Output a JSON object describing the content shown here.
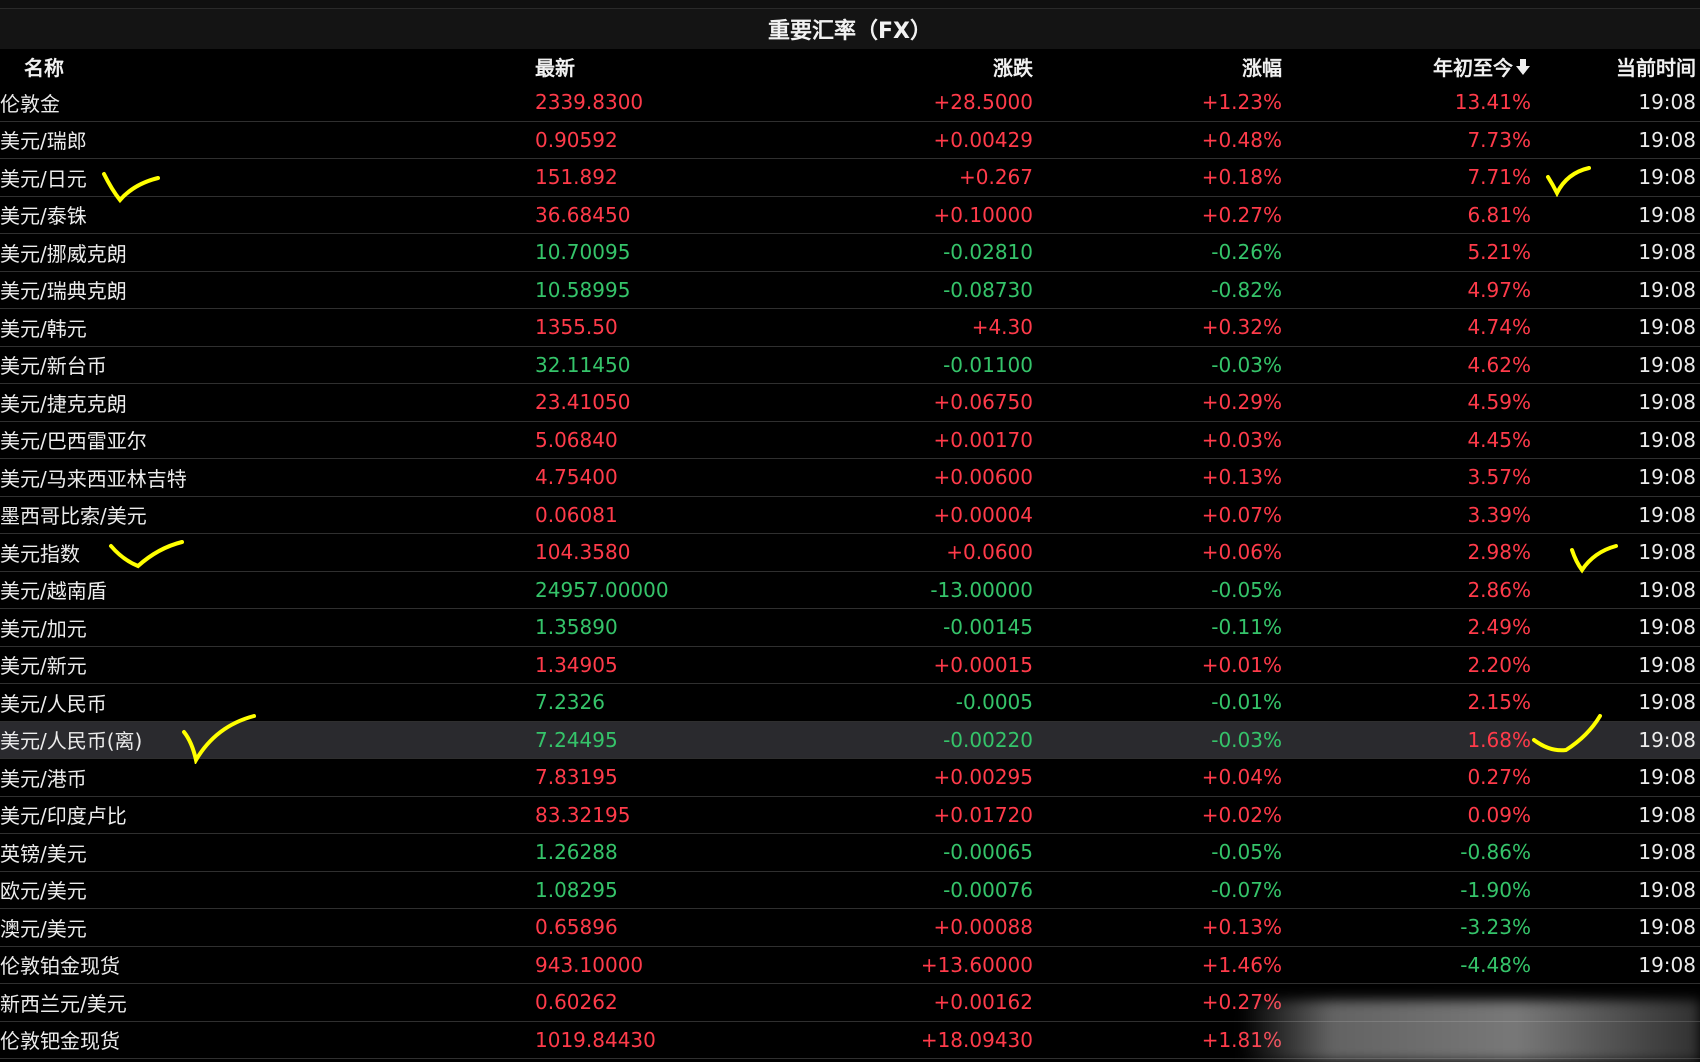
{
  "title": "重要汇率（FX）",
  "columns": {
    "name": "名称",
    "latest": "最新",
    "change": "涨跌",
    "pct": "涨幅",
    "ytd": "年初至今",
    "time": "当前时间"
  },
  "sort_icon": "arrow-down-icon",
  "colors": {
    "up": "#ff3b4a",
    "down": "#35c46a",
    "highlight_row": "#2a2a2e",
    "annotation": "#ffff00"
  },
  "rows": [
    {
      "name": "伦敦金",
      "latest": "2339.8300",
      "change": "+28.5000",
      "pct": "+1.23%",
      "ytd": "13.41%",
      "time": "19:08"
    },
    {
      "name": "美元/瑞郎",
      "latest": "0.90592",
      "change": "+0.00429",
      "pct": "+0.48%",
      "ytd": "7.73%",
      "time": "19:08"
    },
    {
      "name": "美元/日元",
      "latest": "151.892",
      "change": "+0.267",
      "pct": "+0.18%",
      "ytd": "7.71%",
      "time": "19:08"
    },
    {
      "name": "美元/泰铢",
      "latest": "36.68450",
      "change": "+0.10000",
      "pct": "+0.27%",
      "ytd": "6.81%",
      "time": "19:08"
    },
    {
      "name": "美元/挪威克朗",
      "latest": "10.70095",
      "change": "-0.02810",
      "pct": "-0.26%",
      "ytd": "5.21%",
      "time": "19:08"
    },
    {
      "name": "美元/瑞典克朗",
      "latest": "10.58995",
      "change": "-0.08730",
      "pct": "-0.82%",
      "ytd": "4.97%",
      "time": "19:08"
    },
    {
      "name": "美元/韩元",
      "latest": "1355.50",
      "change": "+4.30",
      "pct": "+0.32%",
      "ytd": "4.74%",
      "time": "19:08"
    },
    {
      "name": "美元/新台币",
      "latest": "32.11450",
      "change": "-0.01100",
      "pct": "-0.03%",
      "ytd": "4.62%",
      "time": "19:08"
    },
    {
      "name": "美元/捷克克朗",
      "latest": "23.41050",
      "change": "+0.06750",
      "pct": "+0.29%",
      "ytd": "4.59%",
      "time": "19:08"
    },
    {
      "name": "美元/巴西雷亚尔",
      "latest": "5.06840",
      "change": "+0.00170",
      "pct": "+0.03%",
      "ytd": "4.45%",
      "time": "19:08"
    },
    {
      "name": "美元/马来西亚林吉特",
      "latest": "4.75400",
      "change": "+0.00600",
      "pct": "+0.13%",
      "ytd": "3.57%",
      "time": "19:08"
    },
    {
      "name": "墨西哥比索/美元",
      "latest": "0.06081",
      "change": "+0.00004",
      "pct": "+0.07%",
      "ytd": "3.39%",
      "time": "19:08"
    },
    {
      "name": "美元指数",
      "latest": "104.3580",
      "change": "+0.0600",
      "pct": "+0.06%",
      "ytd": "2.98%",
      "time": "19:08"
    },
    {
      "name": "美元/越南盾",
      "latest": "24957.00000",
      "change": "-13.00000",
      "pct": "-0.05%",
      "ytd": "2.86%",
      "time": "19:08"
    },
    {
      "name": "美元/加元",
      "latest": "1.35890",
      "change": "-0.00145",
      "pct": "-0.11%",
      "ytd": "2.49%",
      "time": "19:08"
    },
    {
      "name": "美元/新元",
      "latest": "1.34905",
      "change": "+0.00015",
      "pct": "+0.01%",
      "ytd": "2.20%",
      "time": "19:08"
    },
    {
      "name": "美元/人民币",
      "latest": "7.2326",
      "change": "-0.0005",
      "pct": "-0.01%",
      "ytd": "2.15%",
      "time": "19:08"
    },
    {
      "name": "美元/人民币(离)",
      "latest": "7.24495",
      "change": "-0.00220",
      "pct": "-0.03%",
      "ytd": "1.68%",
      "time": "19:08"
    },
    {
      "name": "美元/港币",
      "latest": "7.83195",
      "change": "+0.00295",
      "pct": "+0.04%",
      "ytd": "0.27%",
      "time": "19:08"
    },
    {
      "name": "美元/印度卢比",
      "latest": "83.32195",
      "change": "+0.01720",
      "pct": "+0.02%",
      "ytd": "0.09%",
      "time": "19:08"
    },
    {
      "name": "英镑/美元",
      "latest": "1.26288",
      "change": "-0.00065",
      "pct": "-0.05%",
      "ytd": "-0.86%",
      "time": "19:08"
    },
    {
      "name": "欧元/美元",
      "latest": "1.08295",
      "change": "-0.00076",
      "pct": "-0.07%",
      "ytd": "-1.90%",
      "time": "19:08"
    },
    {
      "name": "澳元/美元",
      "latest": "0.65896",
      "change": "+0.00088",
      "pct": "+0.13%",
      "ytd": "-3.23%",
      "time": "19:08"
    },
    {
      "name": "伦敦铂金现货",
      "latest": "943.10000",
      "change": "+13.60000",
      "pct": "+1.46%",
      "ytd": "-4.48%",
      "time": "19:08"
    },
    {
      "name": "新西兰元/美元",
      "latest": "0.60262",
      "change": "+0.00162",
      "pct": "+0.27%",
      "ytd": "",
      "time": ""
    },
    {
      "name": "伦敦钯金现货",
      "latest": "1019.84430",
      "change": "+18.09430",
      "pct": "+1.81%",
      "ytd": "",
      "time": ""
    }
  ]
}
